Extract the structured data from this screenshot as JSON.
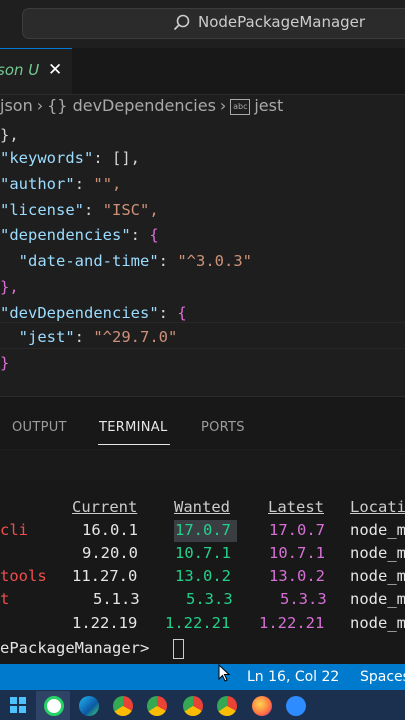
{
  "window": {
    "search_text": "NodePackageManager"
  },
  "tab": {
    "label": "son U",
    "close": "✕"
  },
  "breadcrumb": {
    "file": "json",
    "section": "{} devDependencies",
    "leaf": "jest"
  },
  "editor": {
    "lines": [
      {
        "key": "",
        "text": "},"
      },
      {
        "key": "keywords",
        "value": "[],"
      },
      {
        "key": "author",
        "value": "\"\","
      },
      {
        "key": "license",
        "value": "\"ISC\","
      },
      {
        "key": "dependencies",
        "value": "{"
      },
      {
        "key": "date-and-time",
        "value": "\"^3.0.3\""
      },
      {
        "key": "",
        "text": "},"
      },
      {
        "key": "devDependencies",
        "value": "{"
      },
      {
        "key": "jest",
        "value": "\"^29.7.0\""
      },
      {
        "key": "",
        "text": "}"
      }
    ]
  },
  "panel": {
    "tabs": [
      "OUTPUT",
      "TERMINAL",
      "PORTS"
    ],
    "active_tab": "TERMINAL"
  },
  "terminal": {
    "headers": [
      "Current",
      "Wanted",
      "Latest",
      "Locati"
    ],
    "rows": [
      {
        "pkg": "cli",
        "current": "16.0.1",
        "wanted": "17.0.7",
        "latest": "17.0.7",
        "location": "node_m"
      },
      {
        "pkg": "",
        "current": "9.20.0",
        "wanted": "10.7.1",
        "latest": "10.7.1",
        "location": "node_m"
      },
      {
        "pkg": "tools",
        "current": "11.27.0",
        "wanted": "13.0.2",
        "latest": "13.0.2",
        "location": "node_m"
      },
      {
        "pkg": "t",
        "current": "5.1.3",
        "wanted": "5.3.3",
        "latest": "5.3.3",
        "location": "node_m"
      },
      {
        "pkg": "",
        "current": "1.22.19",
        "wanted": "1.22.21",
        "latest": "1.22.21",
        "location": "node_m"
      }
    ],
    "prompt": "ePackageManager>"
  },
  "statusbar": {
    "position": "Ln 16, Col 22",
    "spaces": "Spaces"
  },
  "colors": {
    "status_bar": "#007acc",
    "key": "#9cdcfe",
    "string": "#ce9178",
    "terminal_red": "#f14c4c",
    "terminal_green": "#23d18b",
    "terminal_magenta": "#d670d6"
  },
  "taskbar": {
    "icons": [
      "start-icon",
      "whatsapp-icon",
      "edge-icon",
      "chrome-icon",
      "chrome-profile-icon",
      "chrome-profile2-icon",
      "chrome-profile3-icon",
      "chrome-profile4-icon",
      "firefox-icon",
      "zoom-icon"
    ]
  }
}
